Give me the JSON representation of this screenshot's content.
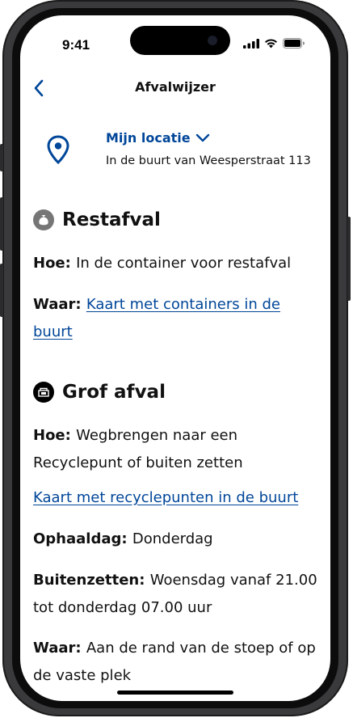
{
  "status_bar": {
    "time": "9:41"
  },
  "nav": {
    "title": "Afvalwijzer"
  },
  "location": {
    "title": "Mijn locatie",
    "subtitle": "In de buurt van Weesperstraat 113"
  },
  "restafval": {
    "heading": "Restafval",
    "hoe_label": "Hoe:",
    "hoe_value": "In de container voor restafval",
    "waar_label": "Waar:",
    "waar_link": "Kaart met containers in de buurt"
  },
  "grof_afval": {
    "heading": "Grof afval",
    "hoe_label": "Hoe:",
    "hoe_value": "Wegbrengen naar een Recyclepunt of buiten zetten",
    "map_link": "Kaart met recyclepunten in de buurt",
    "ophaaldag_label": "Ophaaldag:",
    "ophaaldag_value": "Donderdag",
    "buitenzetten_label": "Buitenzetten:",
    "buitenzetten_value": "Woensdag vanaf 21.00 tot donderdag 07.00 uur",
    "waar_label": "Waar:",
    "waar_value": "Aan de rand van de stoep of op de vaste plek"
  },
  "colors": {
    "accent": "#004699",
    "text": "#111111",
    "icon_grey": "#767676"
  },
  "icons": {
    "back": "chevron-left-icon",
    "location": "location-pin-icon",
    "dropdown": "chevron-down-icon",
    "restafval": "trash-bag-icon",
    "grof_afval": "bulky-waste-icon"
  }
}
